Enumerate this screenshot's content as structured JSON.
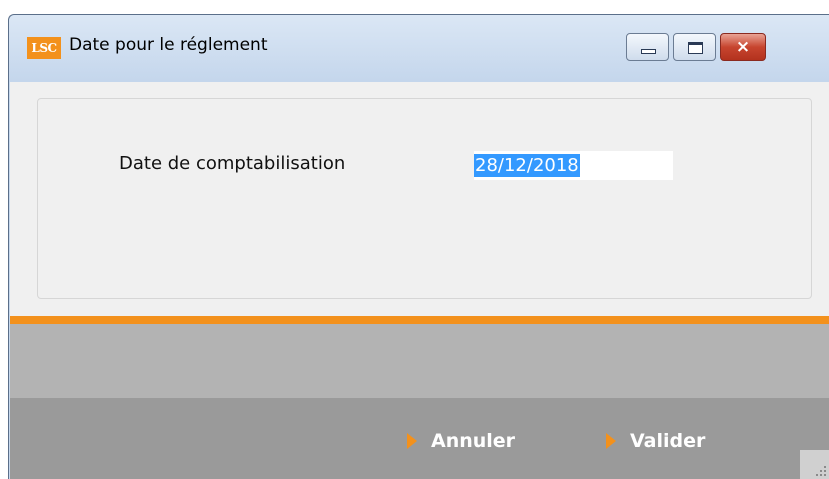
{
  "window": {
    "app_icon_text": "LSC",
    "title": "Date pour le réglement",
    "controls": {
      "minimize": "minimize",
      "maximize": "maximize",
      "close": "×"
    }
  },
  "form": {
    "date_label": "Date de comptabilisation",
    "date_value": "28/12/2018"
  },
  "footer": {
    "cancel_label": "Annuler",
    "validate_label": "Valider"
  },
  "colors": {
    "accent": "#f3911c",
    "selection": "#3399ff",
    "footer_bg": "#9a9a9a",
    "band_bg": "#b3b3b3"
  }
}
